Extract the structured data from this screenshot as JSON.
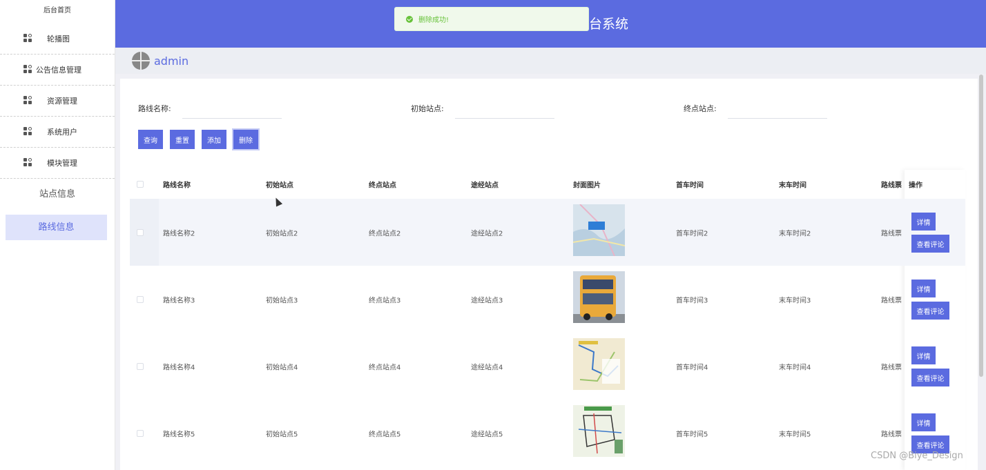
{
  "sidebar": {
    "home": "后台首页",
    "items": [
      {
        "label": "轮播图",
        "icon": "grid-icon"
      },
      {
        "label": "公告信息管理",
        "icon": "grid-icon"
      },
      {
        "label": "资源管理",
        "icon": "grid-icon"
      },
      {
        "label": "系统用户",
        "icon": "grid-icon"
      },
      {
        "label": "模块管理",
        "icon": "grid-icon"
      }
    ],
    "sub_items": [
      "站点信息",
      "路线信息"
    ]
  },
  "header": {
    "title": "台系统",
    "toast": "删除成功!"
  },
  "user": {
    "name": "admin"
  },
  "search": {
    "fields": [
      {
        "label": "路线名称:",
        "placeholder": ""
      },
      {
        "label": "初始站点:",
        "placeholder": ""
      },
      {
        "label": "终点站点:",
        "placeholder": ""
      }
    ],
    "buttons": [
      "查询",
      "重置",
      "添加",
      "删除"
    ]
  },
  "table": {
    "headers": [
      "路线名称",
      "初始站点",
      "终点站点",
      "途经站点",
      "封面图片",
      "首车时间",
      "末车时间",
      "路线票",
      "操作"
    ],
    "rows": [
      {
        "name": "路线名称2",
        "start": "初始站点2",
        "end": "终点站点2",
        "via": "途经站点2",
        "first": "首车时间2",
        "last": "末车时间2",
        "ticket": "路线票",
        "image": "map-thumbnail"
      },
      {
        "name": "路线名称3",
        "start": "初始站点3",
        "end": "终点站点3",
        "via": "途经站点3",
        "first": "首车时间3",
        "last": "末车时间3",
        "ticket": "路线票",
        "image": "bus-photo"
      },
      {
        "name": "路线名称4",
        "start": "初始站点4",
        "end": "终点站点4",
        "via": "途经站点4",
        "first": "首车时间4",
        "last": "末车时间4",
        "ticket": "路线票",
        "image": "route-map"
      },
      {
        "name": "路线名称5",
        "start": "初始站点5",
        "end": "终点站点5",
        "via": "途经站点5",
        "first": "首车时间5",
        "last": "末车时间5",
        "ticket": "路线票",
        "image": "route-map"
      }
    ],
    "actions": {
      "detail": "详情",
      "comment": "查看评论"
    }
  },
  "watermark": "CSDN @Biye_Design",
  "colors": {
    "accent": "#5b6be0",
    "success": "#67c23a",
    "active_bg": "#dfe3fb"
  }
}
